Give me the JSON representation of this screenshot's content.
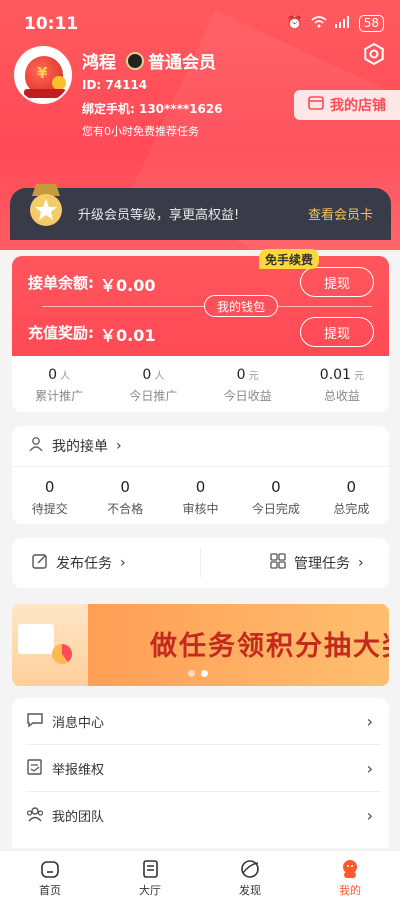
{
  "status_bar": {
    "time": "10:11",
    "battery": "58"
  },
  "profile": {
    "name": "鸿程",
    "member_level": "普通会员",
    "id_text": "ID:  74114",
    "phone_text": "绑定手机:  130****1626",
    "free_text": "您有0小时免费推荐任务"
  },
  "shop_button": "我的店铺",
  "vip": {
    "text": "升级会员等级，享更高权益!",
    "link": "查看会员卡"
  },
  "wallet": {
    "order_balance_label": "接单余额:",
    "order_balance_value": "￥0.00",
    "recharge_label": "充值奖励:",
    "recharge_value": "￥0.01",
    "withdraw_label": "提现",
    "my_wallet": "我的钱包",
    "fee_tag": "免手续费",
    "stats": [
      {
        "value": "0",
        "unit": "人",
        "label": "累计推广"
      },
      {
        "value": "0",
        "unit": "人",
        "label": "今日推广"
      },
      {
        "value": "0",
        "unit": "元",
        "label": "今日收益"
      },
      {
        "value": "0.01",
        "unit": "元",
        "label": "总收益"
      }
    ]
  },
  "orders": {
    "title": "我的接单",
    "items": [
      {
        "value": "0",
        "label": "待提交"
      },
      {
        "value": "0",
        "label": "不合格"
      },
      {
        "value": "0",
        "label": "审核中"
      },
      {
        "value": "0",
        "label": "今日完成"
      },
      {
        "value": "0",
        "label": "总完成"
      }
    ]
  },
  "tasks": {
    "publish": "发布任务",
    "manage": "管理任务"
  },
  "banner": {
    "title": "做任务领积分抽大奖"
  },
  "menu": [
    {
      "label": "消息中心",
      "icon": "message-icon"
    },
    {
      "label": "举报维权",
      "icon": "report-icon"
    },
    {
      "label": "我的团队",
      "icon": "team-icon"
    }
  ],
  "tabs": [
    {
      "label": "首页",
      "icon": "home-icon"
    },
    {
      "label": "大厅",
      "icon": "hall-icon"
    },
    {
      "label": "发现",
      "icon": "discover-icon"
    },
    {
      "label": "我的",
      "icon": "mine-icon"
    }
  ],
  "colors": {
    "primary": "#ff4a57",
    "accent": "#ff5a2b",
    "vip_gold": "#f2c460"
  }
}
